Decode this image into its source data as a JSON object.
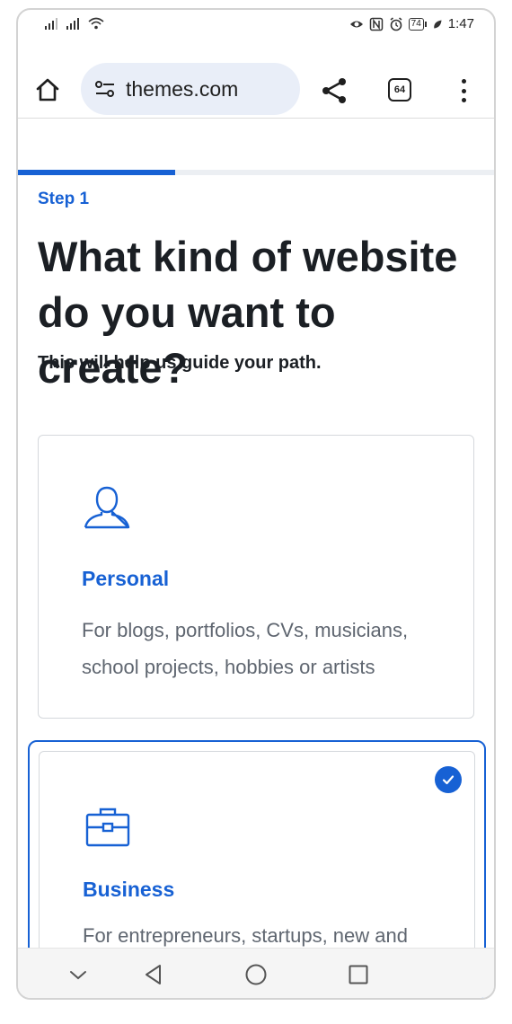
{
  "status_bar": {
    "time": "1:47",
    "battery": "74",
    "icons": [
      "signal-icon",
      "signal-icon",
      "wifi-icon",
      "eye-icon",
      "nfc-icon",
      "alarm-icon",
      "battery-icon",
      "leaf-icon"
    ]
  },
  "browser": {
    "url": "themes.com",
    "tab_count": "64",
    "icons": [
      "home-icon",
      "site-settings-icon",
      "share-icon",
      "tabs-icon",
      "more-vert-icon"
    ]
  },
  "progress": {
    "fraction": 0.33
  },
  "page": {
    "step": "Step 1",
    "heading": "What kind of website do you want to create?",
    "subtext": "This will help us guide your path."
  },
  "options": [
    {
      "icon": "person-icon",
      "title": "Personal",
      "description": "For blogs, portfolios, CVs, musicians, school projects, hobbies or artists",
      "selected": false
    },
    {
      "icon": "briefcase-icon",
      "title": "Business",
      "description": "For entrepreneurs, startups, new and",
      "selected": true
    }
  ],
  "colors": {
    "accent": "#1761d4",
    "text": "#1b1f24",
    "muted": "#5f6670",
    "url_bar": "#e9eef8"
  },
  "navbar": {
    "icons": [
      "hide-keyboard-icon",
      "back-icon",
      "home-circle-icon",
      "recents-icon"
    ]
  }
}
